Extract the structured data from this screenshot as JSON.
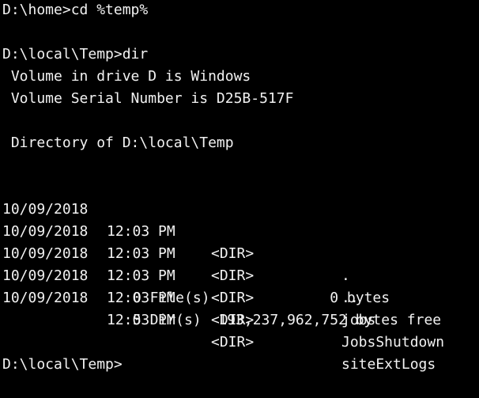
{
  "terminal": {
    "text_color": "#f2f2f2",
    "background_color": "#000000",
    "cmd1": "D:\\home>cd %temp%",
    "cmd2": "D:\\local\\Temp>dir",
    "volume_label_line": " Volume in drive D is Windows",
    "volume_serial_line": " Volume Serial Number is D25B-517F",
    "directory_line": " Directory of D:\\local\\Temp",
    "entries": [
      {
        "date": "10/09/2018",
        "time": "12:03 PM",
        "type": "<DIR>",
        "name": "."
      },
      {
        "date": "10/09/2018",
        "time": "12:03 PM",
        "type": "<DIR>",
        "name": ".."
      },
      {
        "date": "10/09/2018",
        "time": "12:03 PM",
        "type": "<DIR>",
        "name": "jobs"
      },
      {
        "date": "10/09/2018",
        "time": "12:03 PM",
        "type": "<DIR>",
        "name": "JobsShutdown"
      },
      {
        "date": "10/09/2018",
        "time": "12:03 PM",
        "type": "<DIR>",
        "name": "siteExtLogs"
      }
    ],
    "files_summary": "0 File(s)              0 bytes",
    "dirs_summary": "5 Dir(s)  193,237,962,752 bytes free",
    "prompt": "D:\\local\\Temp>"
  }
}
